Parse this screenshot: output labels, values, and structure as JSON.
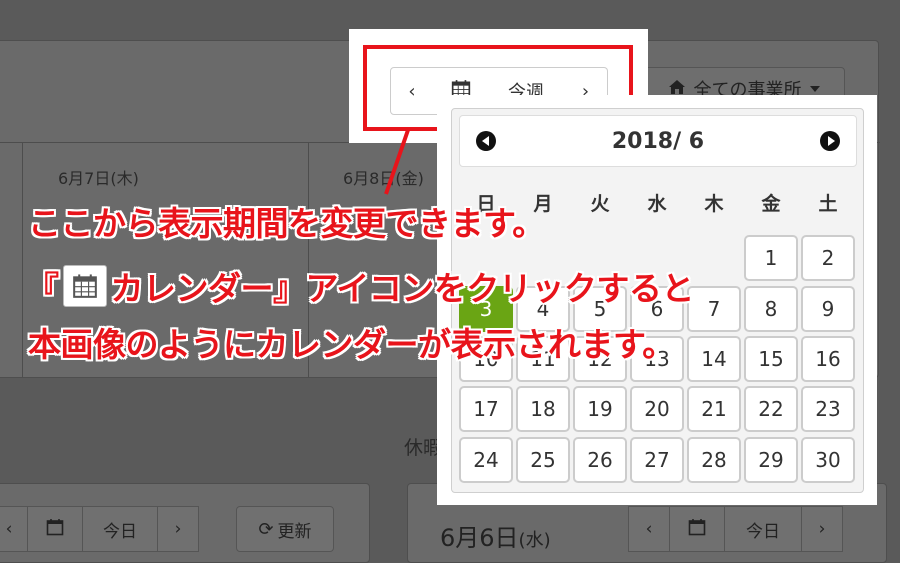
{
  "background": {
    "days": [
      "6月7日(木)",
      "6月8日(金)"
    ],
    "office_filter_label": "全ての事業所",
    "holiday_label": "休暇",
    "bottom_left_toolbar": {
      "prev": "‹",
      "today": "今日",
      "next": "›",
      "refresh": "更新"
    },
    "bottom_right": {
      "date_main": "6月6日",
      "date_weekday": "(水)",
      "prev": "‹",
      "today": "今日",
      "next": "›"
    }
  },
  "toolbar": {
    "prev": "‹",
    "this_week": "今週",
    "next": "›",
    "calendar_icon": "calendar-icon"
  },
  "calendar": {
    "title": "2018/ 6",
    "weekdays": [
      "日",
      "月",
      "火",
      "水",
      "木",
      "金",
      "土"
    ],
    "weeks": [
      [
        "",
        "",
        "",
        "",
        "",
        "1",
        "2"
      ],
      [
        "3",
        "4",
        "5",
        "6",
        "7",
        "8",
        "9"
      ],
      [
        "10",
        "11",
        "12",
        "13",
        "14",
        "15",
        "16"
      ],
      [
        "17",
        "18",
        "19",
        "20",
        "21",
        "22",
        "23"
      ],
      [
        "24",
        "25",
        "26",
        "27",
        "28",
        "29",
        "30"
      ]
    ],
    "today": "3"
  },
  "annotation": {
    "line1": "ここから表示期間を変更できます。",
    "line2_prefix": "『",
    "line2_suffix": "カレンダー』アイコンをクリックすると",
    "line3": "本画像のようにカレンダーが表示されます。"
  },
  "colors": {
    "accent_red": "#e8141b",
    "today_green": "#6aa514"
  }
}
